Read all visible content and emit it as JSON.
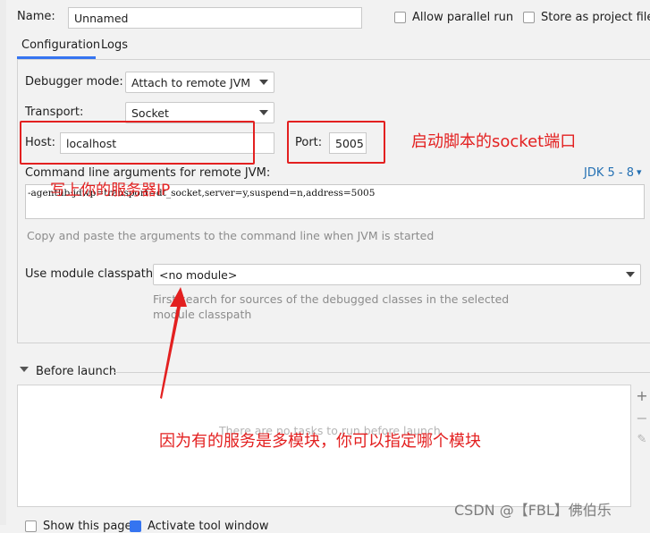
{
  "name": {
    "label": "Name:",
    "value": "Unnamed"
  },
  "options": {
    "parallel_label": "Allow parallel run",
    "store_label": "Store as project file"
  },
  "tabs": [
    {
      "label": "Configuration",
      "active": true
    },
    {
      "label": "Logs",
      "active": false
    }
  ],
  "debugger_mode": {
    "label": "Debugger mode:",
    "value": "Attach to remote JVM"
  },
  "transport": {
    "label": "Transport:",
    "value": "Socket"
  },
  "host": {
    "label": "Host:",
    "value": "localhost"
  },
  "port": {
    "label": "Port:",
    "value": "5005"
  },
  "cmdline": {
    "label": "Command line arguments for remote JVM:",
    "jdk_link": "JDK 5 - 8",
    "value": "-agentlib:jdwp=transport=dt_socket,server=y,suspend=n,address=5005",
    "hint": "Copy and paste the arguments to the command line when JVM is started"
  },
  "module": {
    "label": "Use module classpath:",
    "value": "<no module>",
    "hint_line1": "First search for sources of the debugged classes in the selected",
    "hint_line2": "module classpath"
  },
  "before_launch": {
    "label": "Before launch",
    "empty_text": "There are no tasks to run before launch"
  },
  "annotations": {
    "port": "启动脚本的socket端口",
    "host": "写上你的服务器IP",
    "module": "因为有的服务是多模块，你可以指定哪个模块"
  },
  "bottom": {
    "show_label": "Show this page",
    "activate_label": "Activate tool window"
  },
  "watermark": "CSDN @【FBL】佛伯乐",
  "colors": {
    "annotation": "#e32020",
    "link": "#2470b3",
    "accent": "#3574f0"
  },
  "icons": {
    "add": "plus-icon",
    "remove": "minus-icon",
    "edit": "pencil-icon"
  }
}
